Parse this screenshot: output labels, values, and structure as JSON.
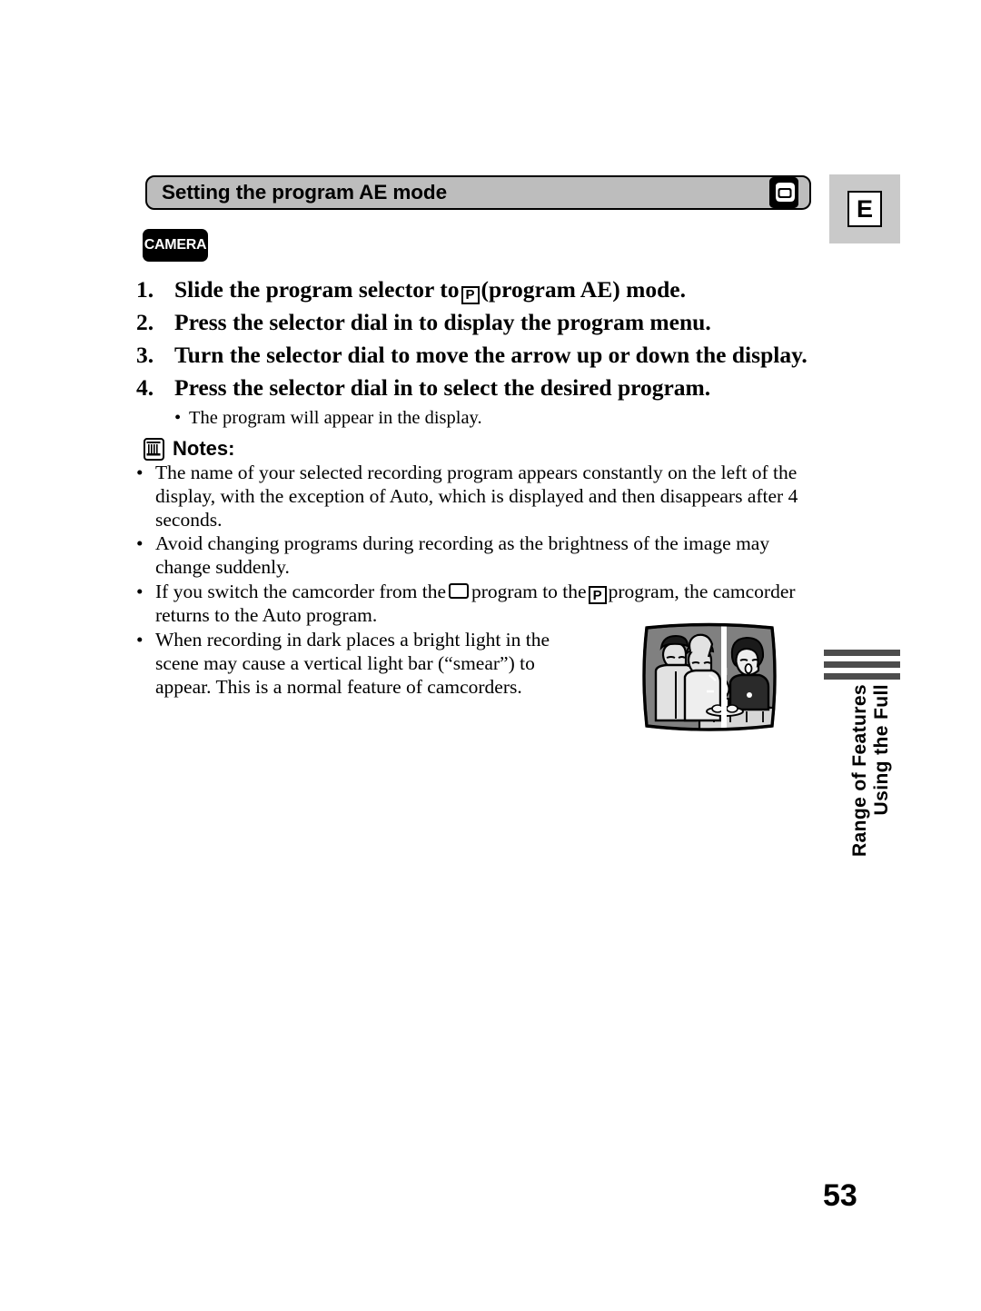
{
  "page": {
    "number": "53",
    "language_tab": "E"
  },
  "header": {
    "title": "Setting the program AE mode",
    "icon": "camcorder-card-icon"
  },
  "mode_badge": {
    "label": "CAMERA"
  },
  "steps": [
    {
      "number": "1.",
      "before": "Slide the program selector to",
      "glyph": "P",
      "after": "(program AE) mode."
    },
    {
      "number": "2.",
      "before": "Press the selector dial in to display the program menu.",
      "glyph": "",
      "after": ""
    },
    {
      "number": "3.",
      "before": "Turn the selector dial to move the arrow up or down the display.",
      "glyph": "",
      "after": ""
    },
    {
      "number": "4.",
      "before": "Press the selector dial in to select the desired program.",
      "glyph": "",
      "after": ""
    }
  ],
  "step_sub_bullet": {
    "dot": "•",
    "text": "The program will appear in the display."
  },
  "notes": {
    "heading": "Notes:",
    "icon": "note-memo-icon",
    "bullet": "•",
    "items": [
      {
        "text": "The name of your selected recording program appears constantly on the left of the display, with the exception of Auto, which is displayed and then disappears after 4 seconds."
      },
      {
        "text": "Avoid changing programs during recording as the brightness of the image may change suddenly."
      },
      {
        "part1": "If you switch the camcorder from the",
        "glyph1": "□",
        "part2": "program to the",
        "glyph2": "P",
        "part3": "program, the camcorder returns to the Auto program."
      },
      {
        "text": "When recording in dark places a bright light in the scene may cause a vertical light bar (“smear”) to appear. This is a normal feature of camcorders."
      }
    ]
  },
  "illustration": {
    "name": "smear-example-tv-screen",
    "description": "TV screen showing people at a birthday cake with a vertical white light bar"
  },
  "side_tab": {
    "line1": "Using the Full",
    "line2": "Range of Features",
    "bars": 3,
    "bar_color": "#4d4d4d"
  },
  "colors": {
    "header_bar": "#bdbdbd",
    "lang_tab": "#c9c9c9",
    "badge": "#000000",
    "illustration_dark": "#7f7f7f",
    "illustration_light": "#d4d4d4"
  }
}
